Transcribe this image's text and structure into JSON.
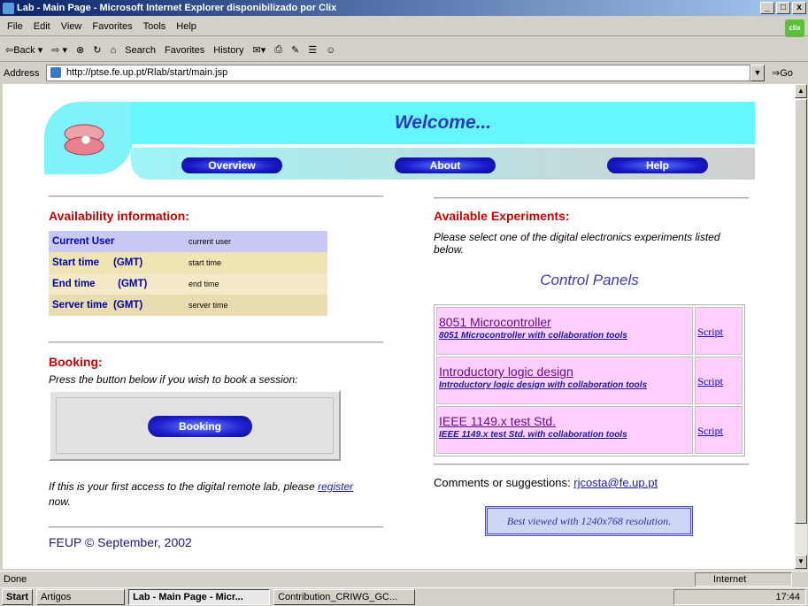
{
  "window": {
    "title": "Lab - Main Page - Microsoft Internet Explorer disponibilizado por Clix",
    "controls": [
      "_",
      "□",
      "x"
    ]
  },
  "menu": [
    "File",
    "Edit",
    "View",
    "Favorites",
    "Tools",
    "Help"
  ],
  "clix_label": "clix",
  "toolbar": {
    "back": "⇦Back ▾",
    "forward": "⇨ ▾",
    "stop": "⊗",
    "refresh": "↻",
    "home": "⌂",
    "search": "Search",
    "favorites": "Favorites",
    "history": "History",
    "mail": "✉▾",
    "print": "⎙",
    "edit": "✎",
    "discuss": "☰",
    "messenger": "☺"
  },
  "address": {
    "label": "Address",
    "url": "http://ptse.fe.up.pt/Rlab/start/main.jsp",
    "go": "⇒Go"
  },
  "page": {
    "welcome": "Welcome...",
    "nav": [
      "Overview",
      "About",
      "Help"
    ],
    "availability": {
      "heading": "Availability information:",
      "rows": [
        {
          "key": "Current User",
          "value": "current user"
        },
        {
          "key": "Start time     (GMT)",
          "value": "start time"
        },
        {
          "key": "End time        (GMT)",
          "value": "end time"
        },
        {
          "key": "Server time  (GMT)",
          "value": "server time"
        }
      ]
    },
    "booking": {
      "heading": "Booking:",
      "text": "Press the button below if you wish to book a session:",
      "button": "Booking"
    },
    "first_access": {
      "before": "If this is your first access to the digital remote lab, please ",
      "link": "register",
      "after": " now."
    },
    "footer": "FEUP © September, 2002",
    "experiments": {
      "heading": "Available Experiments:",
      "intro": "Please select one of the digital electronics experiments listed below.",
      "panels_title": "Control Panels",
      "items": [
        {
          "title": "8051 Microcontroller",
          "subtitle": "8051 Microcontroller with collaboration tools",
          "script": "Script"
        },
        {
          "title": "Introductory logic design",
          "subtitle": "Introductory logic design with collaboration tools",
          "script": "Script"
        },
        {
          "title": "IEEE 1149.x test Std.",
          "subtitle": "IEEE 1149.x test Std. with collaboration tools",
          "script": "Script"
        }
      ]
    },
    "comments": {
      "label": "Comments or suggestions: ",
      "email": "rjcosta@fe.up.pt"
    },
    "best_viewed": "Best viewed with 1240x768 resolution."
  },
  "status": {
    "left": "Done",
    "zone": "Internet"
  },
  "taskbar": {
    "start": "Start",
    "items": [
      "Artigos",
      "Lab - Main Page - Micr...",
      "Contribution_CRIWG_GC..."
    ],
    "time": "17:44"
  }
}
